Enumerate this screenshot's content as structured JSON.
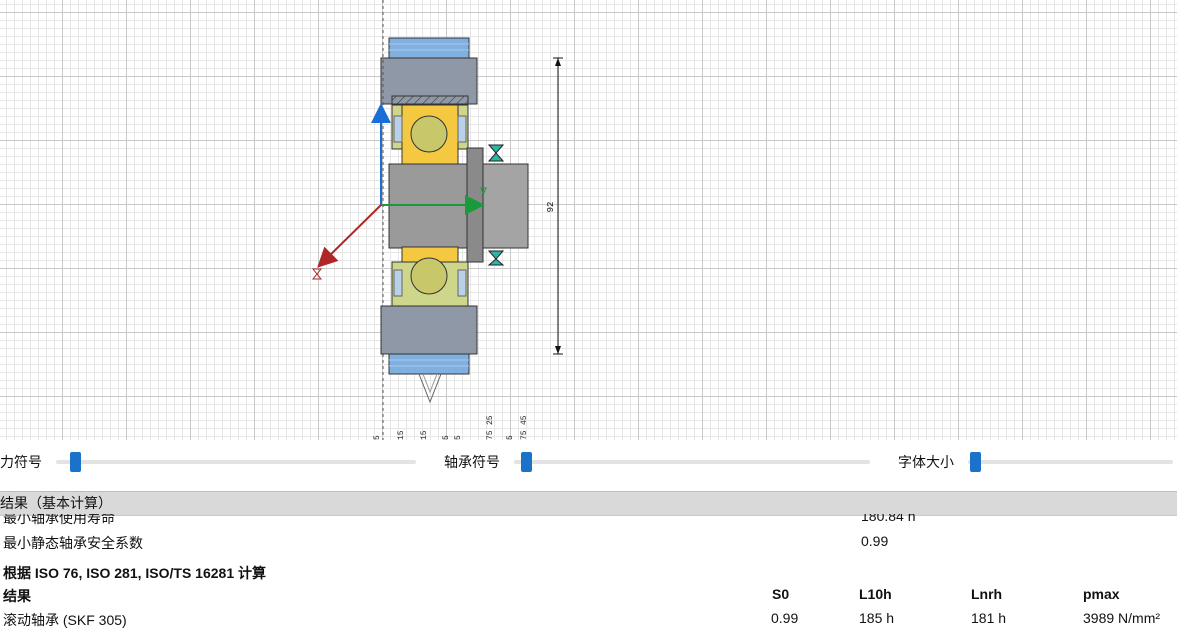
{
  "sliders": [
    {
      "label": "力符号",
      "value_fraction": 0.04
    },
    {
      "label": "轴承符号",
      "value_fraction": 0.02
    },
    {
      "label": "字体大小",
      "value_fraction": 0.01
    }
  ],
  "drawing": {
    "dimension_label": "92",
    "bottom_labels": [
      "5",
      "15",
      "15",
      "5",
      "5",
      "25",
      "75",
      "5",
      "45",
      "75"
    ]
  },
  "results_header": "结果（基本计算）",
  "summary_rows": [
    {
      "label": "最小轴承使用寿命",
      "value": "180.84 h"
    },
    {
      "label": "最小静态轴承安全系数",
      "value": "0.99"
    }
  ],
  "standards_title": "根据 ISO 76, ISO 281, ISO/TS 16281 计算",
  "table": {
    "headers": [
      "结果",
      "S0",
      "L10h",
      "Lnrh",
      "pmax"
    ],
    "rows": [
      {
        "name": "滚动轴承 (SKF 305)",
        "s0": "0.99",
        "l10h": "185 h",
        "lnrh": "181 h",
        "pmax": "3989 N/mm²"
      }
    ]
  },
  "colors": {
    "slider_thumb": "#1a73c9",
    "force_arrow_red": "#b02525",
    "axis_blue": "#1a6fd6",
    "axis_green": "#1a9a3a",
    "bearing_yellow": "#f5c842",
    "housing_blue": "#5b9bd5",
    "shaft_gray": "#9a9a9a"
  }
}
